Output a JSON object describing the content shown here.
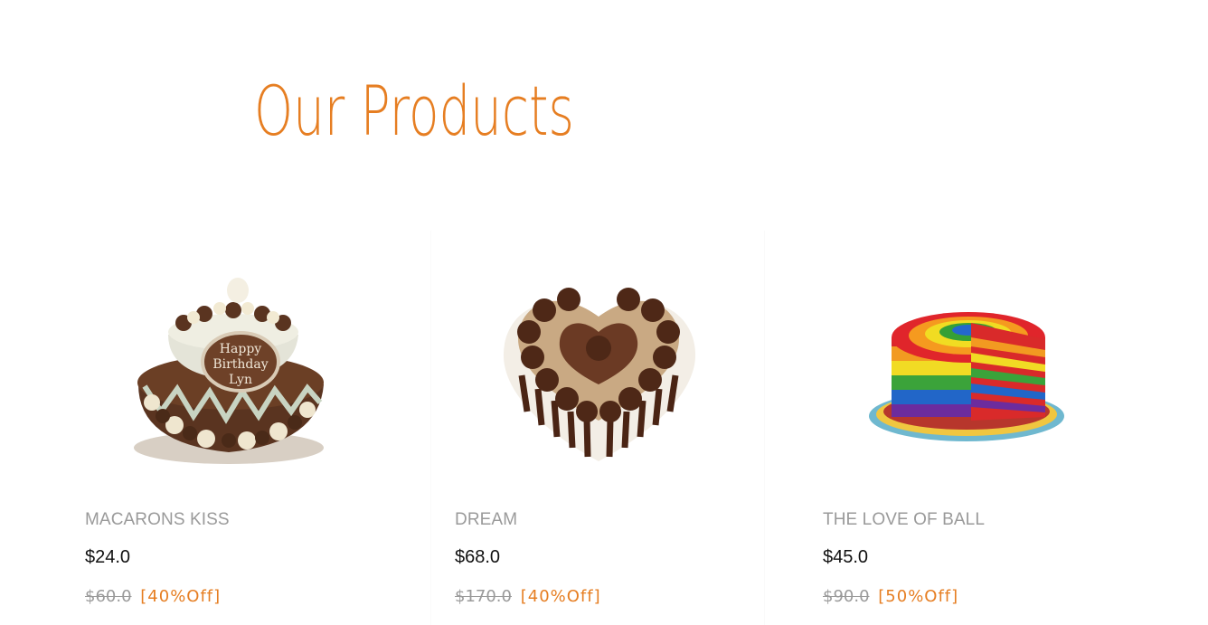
{
  "section": {
    "title": "Our Products"
  },
  "colors": {
    "accent": "#e67e22",
    "muted": "#9a9a9a",
    "price": "#111111"
  },
  "products": [
    {
      "name": "MACARONS KISS",
      "price": "$24.0",
      "old_price": "$60.0",
      "discount": "[40%Off]",
      "image_icon": "tiered-chocolate-cake-image"
    },
    {
      "name": "DREAM",
      "price": "$68.0",
      "old_price": "$170.0",
      "discount": "[40%Off]",
      "image_icon": "heart-chocolate-cake-image"
    },
    {
      "name": "THE LOVE OF BALL",
      "price": "$45.0",
      "old_price": "$90.0",
      "discount": "[50%Off]",
      "image_icon": "rainbow-cake-image"
    }
  ]
}
